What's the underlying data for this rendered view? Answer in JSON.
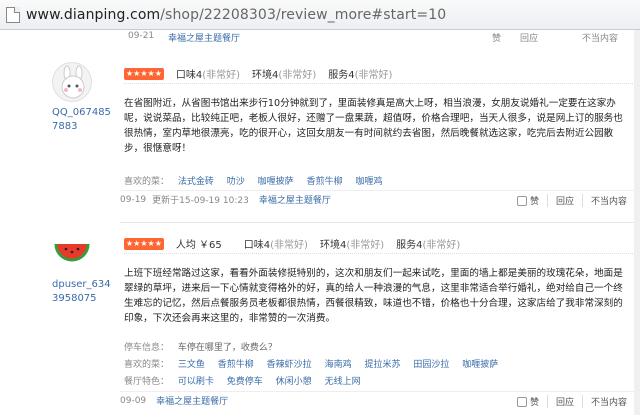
{
  "browser": {
    "url_main": "www.dianping.com",
    "url_rest": "/shop/22208303/review_more#start=10"
  },
  "prev_review": {
    "date": "09-21",
    "shop": "幸福之屋主题餐厅",
    "like": "赞",
    "reply": "回应",
    "report": "不当内容"
  },
  "reviews": [
    {
      "user": "QQ_0674857883",
      "rating_scores": [
        "口味4",
        "环境4",
        "服务4"
      ],
      "rating_labels": [
        "(非常好)",
        "(非常好)",
        "(非常好)"
      ],
      "body": "在省图附近，从省图书馆出来步行10分钟就到了，里面装修真是高大上呀，相当浪漫，女朋友说婚礼一定要在这家办呢，说说菜品，比较纯正吧，老板人很好，还赠了一盘果蔬，超值呀，价格合理吧，当天人很多，说是网上订的服务也很热情，室内草地很漂亮，吃的很开心，这回女朋友一有时间就约去省图，然后晚餐就选这家，吃完后去附近公园散步，很惬意呀！",
      "tags_label": "喜欢的菜：",
      "tags": [
        "法式金砖",
        "叻沙",
        "咖喱披萨",
        "香煎牛柳",
        "咖喱鸡"
      ],
      "date": "09-19",
      "edit": "更新于15-09-19 10:23",
      "shop": "幸福之屋主题餐厅",
      "like": "赞",
      "reply": "回应",
      "report": "不当内容"
    },
    {
      "user": "dpuser_6343958075",
      "price": "人均 ￥65",
      "rating_scores": [
        "口味4",
        "环境4",
        "服务4"
      ],
      "rating_labels": [
        "(非常好)",
        "(非常好)",
        "(非常好)"
      ],
      "body": "上班下班经常路过这家，看看外面装修挺特别的，这次和朋友们一起来试吃，里面的墙上都是美丽的玫瑰花朵，地面是翠绿的草坪，进来后一下心情就变得格外的好，真的给人一种浪漫的气息，这里非常适合举行婚礼，绝对给自己一个终生难忘的记忆，然后点餐服务员老板都很热情，西餐很精致，味道也不错，价格也十分合理，这家店给了我非常深刻的印象，下次还会再来这里的，非常赞的一次消费。",
      "parking_label": "停车信息：",
      "parking": "车停在哪里了，收费么？",
      "tags_label": "喜欢的菜：",
      "tags": [
        "三文鱼",
        "香煎牛柳",
        "香辣虾沙拉",
        "海南鸡",
        "提拉米苏",
        "田园沙拉",
        "咖喱披萨"
      ],
      "features_label": "餐厅特色：",
      "features": [
        "可以刷卡",
        "免费停车",
        "休闲小憩",
        "无线上网"
      ],
      "date": "09-09",
      "shop": "幸福之屋主题餐厅",
      "like": "赞",
      "reply": "回应",
      "report": "不当内容"
    }
  ]
}
